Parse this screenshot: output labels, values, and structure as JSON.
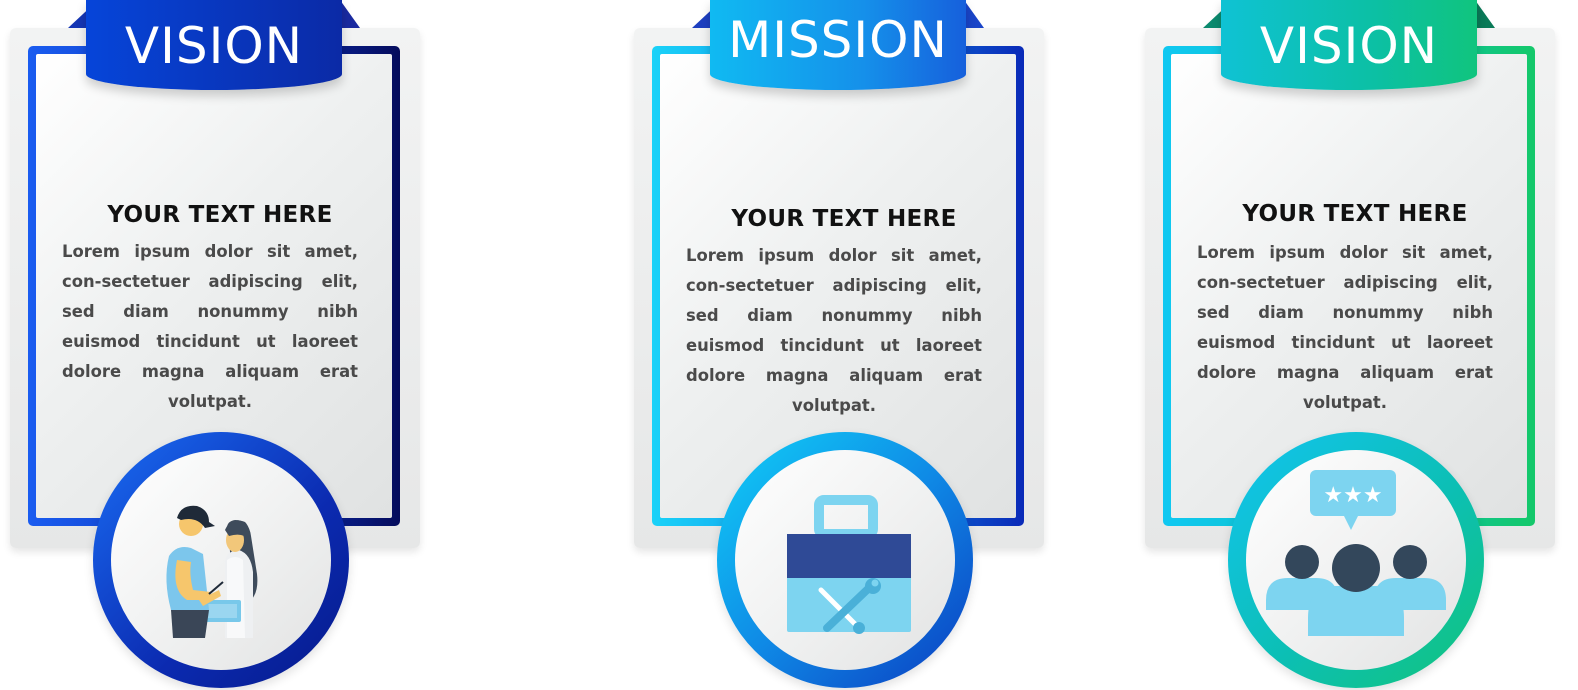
{
  "cards": [
    {
      "banner": "VISION",
      "heading": "YOUR TEXT HERE",
      "body": "Lorem ipsum dolor sit amet, con-sectetuer adipiscing elit, sed diam nonummy nibh euismod tincidunt ut laoreet dolore magna aliquam erat volutpat.",
      "icon": "people-checklist-icon"
    },
    {
      "banner": "MISSION",
      "heading": "YOUR TEXT HERE",
      "body": "Lorem ipsum dolor sit amet, con-sectetuer adipiscing elit, sed diam nonummy nibh euismod tincidunt ut laoreet dolore magna aliquam erat volutpat.",
      "icon": "toolbox-icon"
    },
    {
      "banner": "VISION",
      "heading": "YOUR TEXT HERE",
      "body": "Lorem ipsum dolor sit amet, con-sectetuer adipiscing elit, sed diam nonummy nibh euismod tincidunt ut laoreet dolore magna aliquam erat volutpat.",
      "icon": "team-rating-icon"
    }
  ],
  "colors": {
    "blue_dark": "#0a1f8f",
    "blue_mid": "#1548d8",
    "cyan": "#0ec7f2",
    "teal": "#0bbfa8",
    "green": "#17c778"
  }
}
